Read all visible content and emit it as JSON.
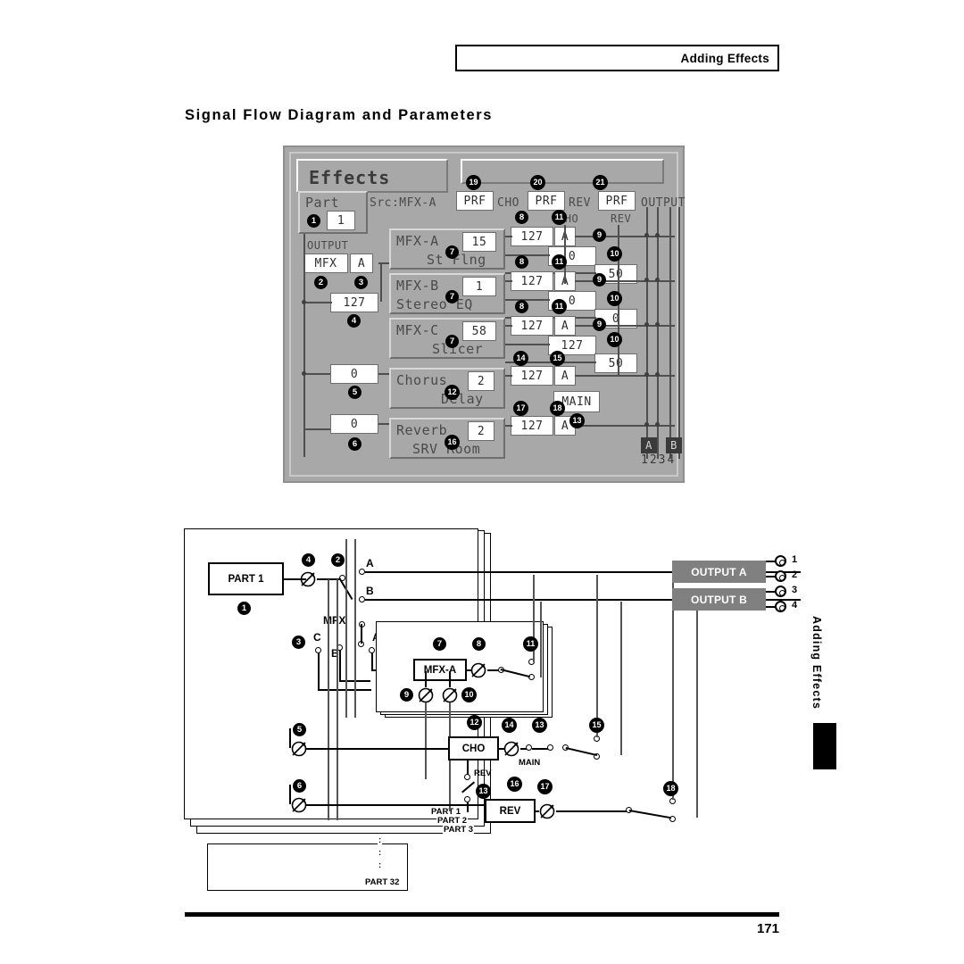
{
  "header": {
    "running_head": "Adding Effects"
  },
  "page_title": "Signal Flow Diagram and Parameters",
  "footer": {
    "page_number": "171"
  },
  "side_tab": {
    "label": "Adding Effects"
  },
  "lcd": {
    "screen_title": "Effects",
    "part_label": "Part",
    "part_value": "1",
    "output_label": "OUTPUT",
    "output_dest": "MFX",
    "output_mfx_select": "A",
    "output_level": "127",
    "src_label": "Src:MFX-A",
    "src_value": "PRF",
    "cho_label": "CHO",
    "cho_value": "PRF",
    "rev_label": "REV",
    "rev_value": "PRF",
    "output_bus_label": "OUTPUT",
    "cho_col_label": "CHO",
    "rev_col_label": "REV",
    "main_label": "MAIN",
    "bus_a": "A",
    "bus_b": "B",
    "bus_digits": "1234",
    "rows": [
      {
        "name": "MFX-A",
        "number": "15",
        "type": "St Flng",
        "level": "127",
        "out": "A",
        "cho_send": "0",
        "rev_send": "50"
      },
      {
        "name": "MFX-B",
        "number": "1",
        "type": "Stereo EQ",
        "level": "127",
        "out": "A",
        "cho_send": "0",
        "rev_send": "0"
      },
      {
        "name": "MFX-C",
        "number": "58",
        "type": "Slicer",
        "level": "127",
        "out": "A",
        "cho_send": "127",
        "rev_send": "50"
      },
      {
        "name": "Chorus",
        "number": "2",
        "type": "Delay",
        "level": "127",
        "out": "A"
      },
      {
        "name": "Reverb",
        "number": "2",
        "type": "SRV Room",
        "level": "127",
        "out": "A"
      }
    ],
    "mfx_cho_zero": "0",
    "rev_cho_zero": "0"
  },
  "diagram": {
    "part_box": "PART 1",
    "mfx_label": "MFX",
    "mfx_block": "MFX-A",
    "cho_block": "CHO",
    "rev_block": "REV",
    "main_label": "MAIN",
    "rev_tap_label": "REV",
    "route_a": "A",
    "route_b": "B",
    "route_c": "C",
    "mfx_sel_a": "A",
    "mfx_sel_b": "B",
    "output_a": "OUTPUT A",
    "output_b": "OUTPUT B",
    "jack_numbers": [
      "1",
      "2",
      "3",
      "4"
    ],
    "part_layers": [
      "PART 1",
      "PART 2",
      "PART 3",
      "PART 32"
    ],
    "ellipsis": ":"
  },
  "callouts": {
    "n1": "1",
    "n2": "2",
    "n3": "3",
    "n4": "4",
    "n5": "5",
    "n6": "6",
    "n7": "7",
    "n8": "8",
    "n9": "9",
    "n10": "10",
    "n11": "11",
    "n12": "12",
    "n13": "13",
    "n14": "14",
    "n15": "15",
    "n16": "16",
    "n17": "17",
    "n18": "18",
    "n19": "19",
    "n20": "20",
    "n21": "21"
  }
}
